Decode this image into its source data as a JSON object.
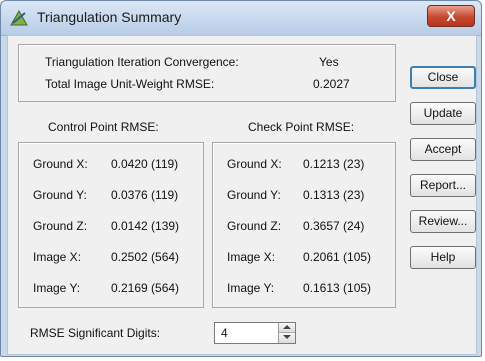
{
  "window": {
    "title": "Triangulation Summary",
    "close_label": "X"
  },
  "summary": {
    "convergence_label": "Triangulation Iteration Convergence:",
    "convergence_value": "Yes",
    "rmse_label": "Total Image Unit-Weight RMSE:",
    "rmse_value": "0.2027"
  },
  "control": {
    "header": "Control Point RMSE:",
    "rows": [
      {
        "label": "Ground X:",
        "value": "0.0420 (119)"
      },
      {
        "label": "Ground Y:",
        "value": "0.0376 (119)"
      },
      {
        "label": "Ground Z:",
        "value": "0.0142 (139)"
      },
      {
        "label": "Image X:",
        "value": "0.2502 (564)"
      },
      {
        "label": "Image Y:",
        "value": "0.2169 (564)"
      }
    ]
  },
  "check": {
    "header": "Check Point RMSE:",
    "rows": [
      {
        "label": "Ground X:",
        "value": "0.1213 (23)"
      },
      {
        "label": "Ground Y:",
        "value": "0.1313 (23)"
      },
      {
        "label": "Ground Z:",
        "value": "0.3657 (24)"
      },
      {
        "label": "Image X:",
        "value": "0.2061 (105)"
      },
      {
        "label": "Image Y:",
        "value": "0.1613 (105)"
      }
    ]
  },
  "digits": {
    "label": "RMSE Significant Digits:",
    "value": "4"
  },
  "buttons": {
    "close": "Close",
    "update": "Update",
    "accept": "Accept",
    "report": "Report...",
    "review": "Review...",
    "help": "Help"
  },
  "colors": {
    "title_bar": "#c9d9ec",
    "close_button": "#c6492f",
    "default_button_border": "#3c7fb1"
  },
  "icons": {
    "app": "triangulation-icon"
  }
}
